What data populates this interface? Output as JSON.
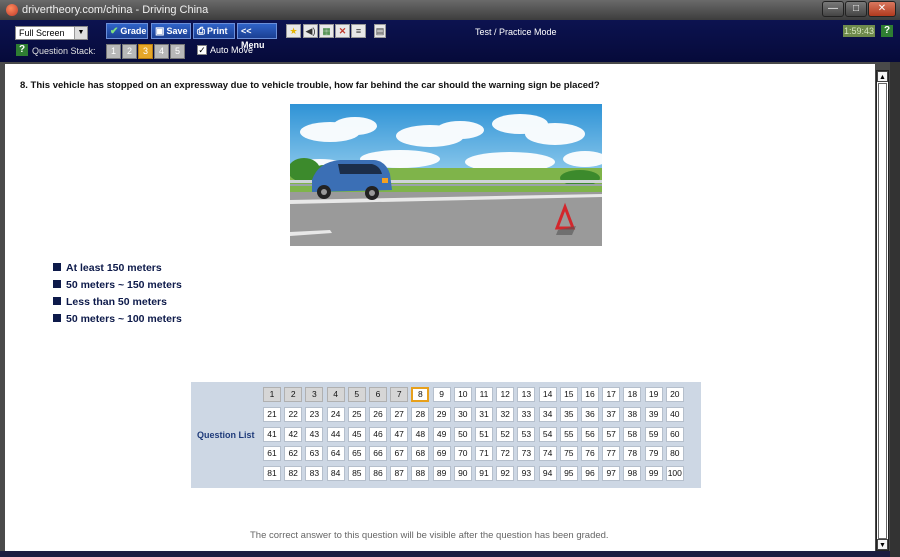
{
  "window": {
    "title": "drivertheory.com/china - Driving China",
    "minimize": "—",
    "maximize": "□",
    "close": "✕"
  },
  "toolbar": {
    "view_select": "Full Screen",
    "grade": "Grade",
    "save": "Save",
    "print": "Print",
    "menu": "<< Menu",
    "mode": "Test / Practice Mode",
    "timer": "1:59:43",
    "help": "?",
    "question_stack_label": "Question Stack:",
    "question_stack": [
      "1",
      "2",
      "3",
      "4",
      "5"
    ],
    "question_stack_active": "3",
    "auto_move_label": "Auto Move",
    "auto_move_checked": true
  },
  "question": {
    "text": "8. This vehicle has stopped on an expressway due to vehicle trouble, how far behind the car should the warning sign be placed?",
    "answers": [
      "At least 150 meters",
      "50 meters ~ 150 meters",
      "Less than 50 meters",
      "50 meters ~ 100 meters"
    ]
  },
  "question_list": {
    "label": "Question List",
    "numbers": [
      "1",
      "2",
      "3",
      "4",
      "5",
      "6",
      "7",
      "8",
      "9",
      "10",
      "11",
      "12",
      "13",
      "14",
      "15",
      "16",
      "17",
      "18",
      "19",
      "20",
      "21",
      "22",
      "23",
      "24",
      "25",
      "26",
      "27",
      "28",
      "29",
      "30",
      "31",
      "32",
      "33",
      "34",
      "35",
      "36",
      "37",
      "38",
      "39",
      "40",
      "41",
      "42",
      "43",
      "44",
      "45",
      "46",
      "47",
      "48",
      "49",
      "50",
      "51",
      "52",
      "53",
      "54",
      "55",
      "56",
      "57",
      "58",
      "59",
      "60",
      "61",
      "62",
      "63",
      "64",
      "65",
      "66",
      "67",
      "68",
      "69",
      "70",
      "71",
      "72",
      "73",
      "74",
      "75",
      "76",
      "77",
      "78",
      "79",
      "80",
      "81",
      "82",
      "83",
      "84",
      "85",
      "86",
      "87",
      "88",
      "89",
      "90",
      "91",
      "92",
      "93",
      "94",
      "95",
      "96",
      "97",
      "98",
      "99",
      "100"
    ],
    "answered_through": 7,
    "current": 8
  },
  "footnote": "The correct answer to this question will be visible after the question has been graded.",
  "colors": {
    "toolbar_bg": "#0a1048",
    "answer_text": "#0d1a4a",
    "current_highlight": "#e7a01c",
    "qlist_bg": "#cdd7e4"
  }
}
